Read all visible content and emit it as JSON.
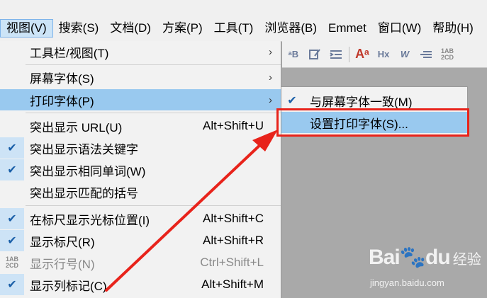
{
  "menubar": {
    "items": [
      {
        "label": "视图(V)",
        "active": true
      },
      {
        "label": "搜索(S)"
      },
      {
        "label": "文档(D)"
      },
      {
        "label": "方案(P)"
      },
      {
        "label": "工具(T)"
      },
      {
        "label": "浏览器(B)"
      },
      {
        "label": "Emmet"
      },
      {
        "label": "窗口(W)"
      },
      {
        "label": "帮助(H)"
      }
    ]
  },
  "view_menu": {
    "toolbar_view": "工具栏/视图(T)",
    "screen_font": "屏幕字体(S)",
    "print_font": "打印字体(P)",
    "highlight_url": "突出显示 URL(U)",
    "highlight_url_shortcut": "Alt+Shift+U",
    "highlight_syntax": "突出显示语法关键字",
    "highlight_same_word": "突出显示相同单词(W)",
    "highlight_brackets": "突出显示匹配的括号",
    "ruler_cursor_pos": "在标尺显示光标位置(I)",
    "ruler_cursor_pos_shortcut": "Alt+Shift+C",
    "show_ruler": "显示标尺(R)",
    "show_ruler_shortcut": "Alt+Shift+R",
    "show_line_numbers": "显示行号(N)",
    "show_line_numbers_shortcut": "Ctrl+Shift+L",
    "show_column_marker": "显示列标记(C)",
    "show_column_marker_shortcut": "Alt+Shift+M",
    "line_number_icon": "1AB 2CD"
  },
  "print_font_submenu": {
    "same_as_screen": "与屏幕字体一致(M)",
    "set_print_font": "设置打印字体(S)..."
  },
  "toolbar": {
    "icons": [
      "font-size-icon",
      "edit-icon",
      "indent-icon",
      "font-color-icon",
      "hex-icon",
      "word-wrap-icon",
      "align-icon",
      "line-number-icon"
    ],
    "line_number_icon_text": "1AB 2CD"
  },
  "watermark": {
    "logo": "Bai",
    "logo_suffix": "du",
    "cn": "经验",
    "url": "jingyan.baidu.com"
  },
  "colors": {
    "highlight": "#99c9ef",
    "annotation_red": "#e8231b",
    "check_blue": "#1a5fa8"
  }
}
